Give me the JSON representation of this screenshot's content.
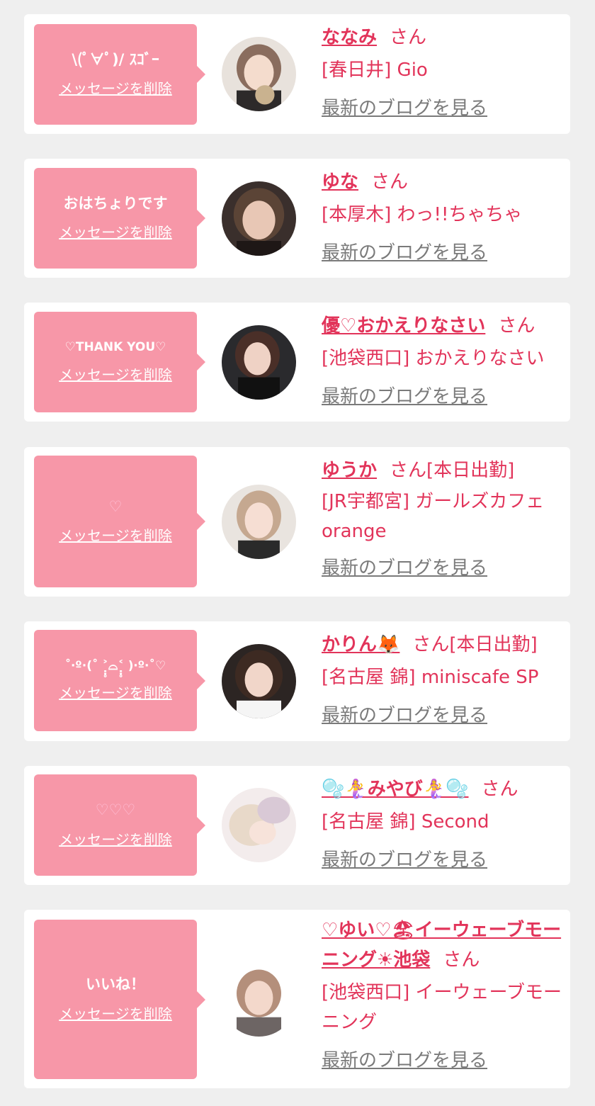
{
  "cards": [
    {
      "message": "\\(ﾟ∀ﾟ)/ ｽｺﾞｰ",
      "delete_label": "メッセージを削除",
      "name": "ななみ",
      "suffix": "さん",
      "shop": "[春日井] Gio",
      "blog_link": "最新のブログを見る",
      "avatar": {
        "bg": "#e8e2dc",
        "hair": "#8a6d5e",
        "skin": "#f4dccd",
        "accent": "#c9b28f"
      }
    },
    {
      "message": "おはちょりです",
      "delete_label": "メッセージを削除",
      "name": "ゆな",
      "suffix": "さん",
      "shop": "[本厚木] わっ!!ちゃちゃ",
      "blog_link": "最新のブログを見る",
      "avatar": {
        "bg": "#3a2f2c",
        "hair": "#5b4436",
        "skin": "#e8c7b5",
        "accent": "#1e1716"
      }
    },
    {
      "message": "♡THANK YOU♡",
      "delete_label": "メッセージを削除",
      "name": "優♡おかえりなさい",
      "suffix": "さん",
      "shop": "[池袋西口] おかえりなさい",
      "blog_link": "最新のブログを見る",
      "avatar": {
        "bg": "#2a2a2d",
        "hair": "#4a2f28",
        "skin": "#efd2c5",
        "accent": "#111111"
      }
    },
    {
      "message": "♡",
      "delete_label": "メッセージを削除",
      "name": "ゆうか",
      "suffix": "さん[本日出勤]",
      "shop": "[JR宇都宮] ガールズカフェorange",
      "blog_link": "最新のブログを見る",
      "avatar": {
        "bg": "#e9e4df",
        "hair": "#c5a890",
        "skin": "#f6ded3",
        "accent": "#2a2a2a"
      }
    },
    {
      "message": "˚‧º·(˚ ˃̣̣̥⌓˂̣̣̥ )‧º·˚♡",
      "delete_label": "メッセージを削除",
      "name": "かりん🦊",
      "suffix": "さん[本日出勤]",
      "shop": "[名古屋 錦] miniscafe SP",
      "blog_link": "最新のブログを見る",
      "avatar": {
        "bg": "#2c2523",
        "hair": "#3d2a22",
        "skin": "#f1d6c9",
        "accent": "#f5f5f5"
      }
    },
    {
      "message": "♡♡♡",
      "delete_label": "メッセージを削除",
      "name": "🫧🧜‍♀️みやび🧜‍♀️🫧",
      "suffix": "さん",
      "shop": "[名古屋 錦] Second",
      "blog_link": "最新のブログを見る",
      "avatar": {
        "bg": "#f3ecec",
        "hair": "#e8d9c9",
        "skin": "#f7e3da",
        "accent": "#d9c9d6"
      }
    },
    {
      "message": "いいね！",
      "delete_label": "メッセージを削除",
      "name": "♡ゆい♡🏖イーウェーブモーニング☀池袋",
      "suffix": "さん",
      "shop": "[池袋西口] イーウェーブモーニング",
      "blog_link": "最新のブログを見る",
      "avatar": {
        "bg": "#ffffff",
        "hair": "#b48f7b",
        "skin": "#f3d8cb",
        "accent": "#6d6564"
      }
    }
  ]
}
